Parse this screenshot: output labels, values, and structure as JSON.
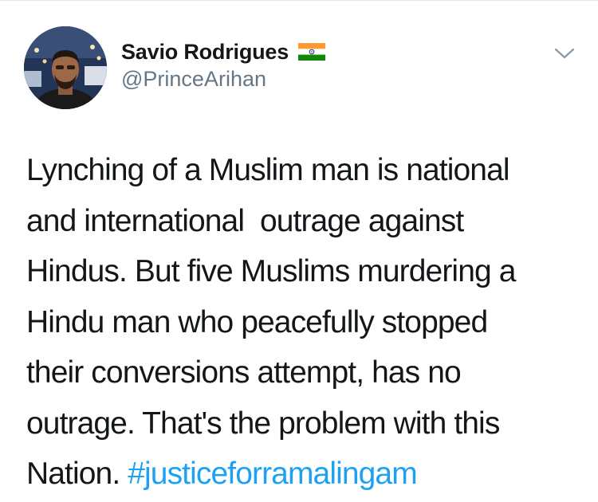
{
  "tweet": {
    "author": {
      "display_name": "Savio Rodrigues",
      "handle": "@PrinceArihan",
      "flag_icon": "india-flag-icon"
    },
    "text_lines": [
      "Lynching of a Muslim man is national",
      "and international  outrage against",
      "Hindus. But five Muslims murdering a",
      "Hindu man who peacefully stopped",
      "their conversions attempt, has no",
      "outrage. That's the problem with this",
      "Nation. "
    ],
    "hashtag": "#justiceforramalingam",
    "menu_icon": "chevron-down-icon"
  },
  "colors": {
    "text": "#14171a",
    "secondary": "#657786",
    "link": "#1da1f2",
    "divider": "#e1e8ed"
  }
}
